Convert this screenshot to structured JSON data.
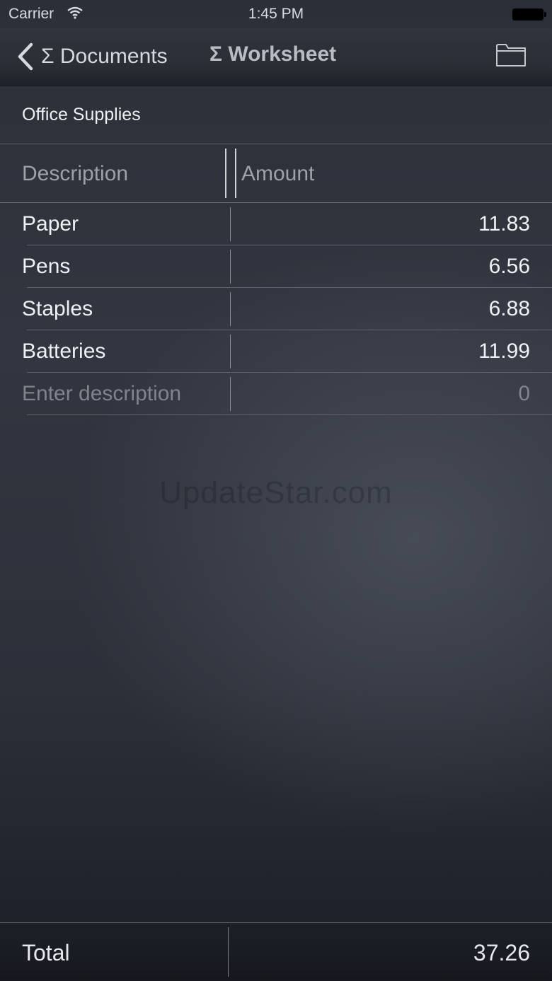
{
  "status_bar": {
    "carrier": "Carrier",
    "time": "1:45 PM",
    "wifi_icon": "wifi-icon",
    "battery_icon": "battery-icon"
  },
  "nav": {
    "back_label": "Σ Documents",
    "title": "Σ Worksheet",
    "back_icon": "chevron-left-icon",
    "folder_icon": "folder-icon"
  },
  "sheet": {
    "title": "Office Supplies"
  },
  "table": {
    "columns": [
      "Description",
      "Amount"
    ],
    "rows": [
      {
        "description": "Paper",
        "amount": "11.83"
      },
      {
        "description": "Pens",
        "amount": "6.56"
      },
      {
        "description": "Staples",
        "amount": "6.88"
      },
      {
        "description": "Batteries",
        "amount": "11.99"
      }
    ],
    "new_row": {
      "description_placeholder": "Enter description",
      "amount_placeholder": "0"
    }
  },
  "watermark": "UpdateStar.com",
  "footer": {
    "total_label": "Total",
    "total_value": "37.26"
  }
}
